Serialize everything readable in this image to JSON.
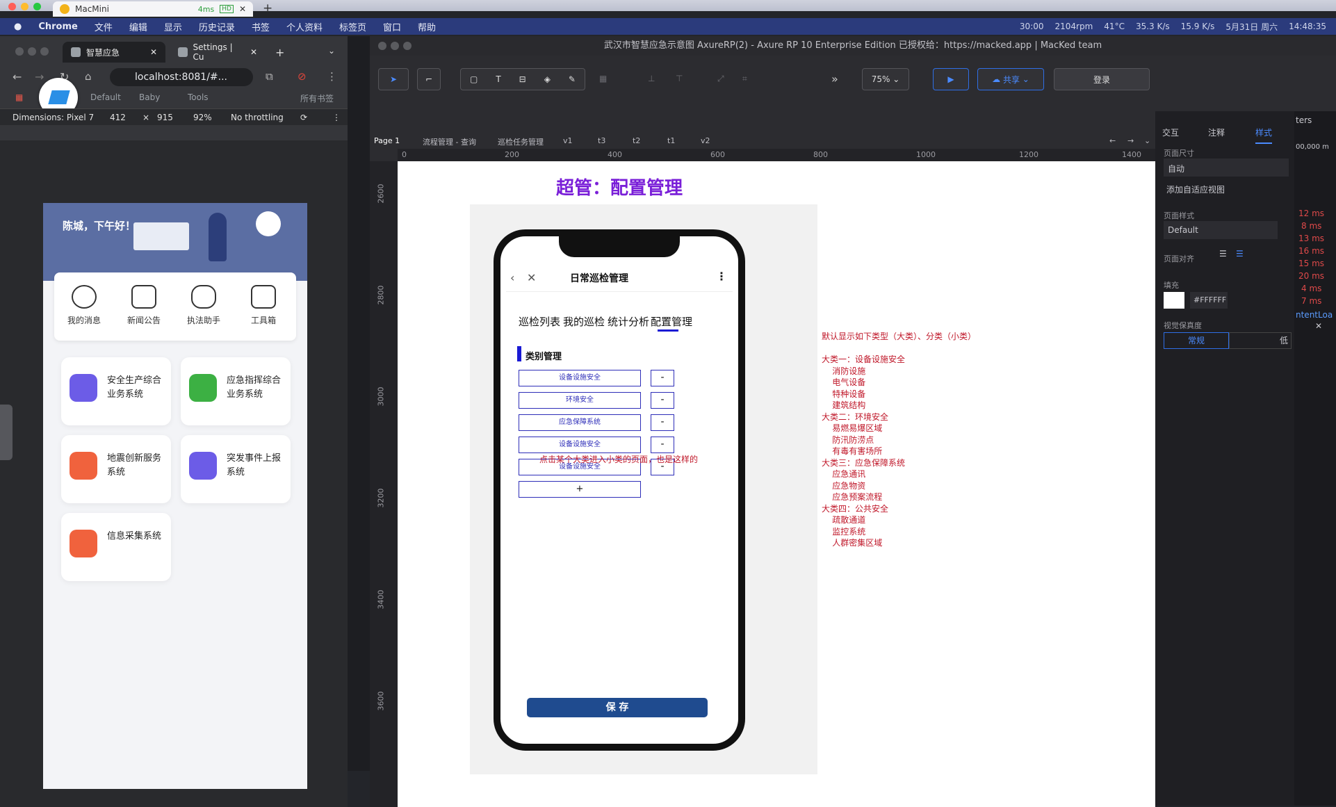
{
  "os": {
    "tab_title": "MacMini",
    "tab_ping": "4ms",
    "tab_hd": "HD"
  },
  "menubar": {
    "apple": "",
    "items": [
      "Chrome",
      "文件",
      "编辑",
      "显示",
      "历史记录",
      "书签",
      "个人资料",
      "标签页",
      "窗口",
      "帮助"
    ],
    "status": [
      "30:00",
      "2104rpm",
      "41°C",
      "35.3 K/s",
      "15.9 K/s",
      "5月31日 周六",
      "14:48:35"
    ]
  },
  "chrome": {
    "tabs": [
      "智慧应急",
      "Settings | Cu"
    ],
    "address": "localhost:8081/#...",
    "bookmarks": [
      "Default",
      "Baby",
      "Tools",
      "所有书签"
    ],
    "device": {
      "dimensions_label": "Dimensions: Pixel 7",
      "width": "412",
      "height": "915",
      "zoom": "92%",
      "throttling": "No throttling"
    }
  },
  "app": {
    "greeting": "陈城，下午好！",
    "quick_entries": [
      "我的消息",
      "新闻公告",
      "执法助手",
      "工具箱"
    ],
    "cards": [
      {
        "label": "安全生产综合业务系统",
        "color": "#6c5ce7"
      },
      {
        "label": "应急指挥综合业务系统",
        "color": "#3cb043"
      },
      {
        "label": "地震创新服务系统",
        "color": "#f0623d"
      },
      {
        "label": "突发事件上报系统",
        "color": "#6c5ce7"
      },
      {
        "label": "信息采集系统",
        "color": "#f0623d"
      }
    ]
  },
  "axure": {
    "window_title": "武汉市智慧应急示意图 AxureRP(2) - Axure RP 10 Enterprise Edition 已授权给：https://macked.app | MacKed team",
    "zoom": "75%",
    "share": "共享",
    "login": "登录",
    "page_tabs": [
      "Page 1",
      "流程管理 - 查询",
      "巡检任务管理",
      "v1",
      "t3",
      "t2",
      "t1",
      "v2"
    ],
    "ruler_marks": [
      "0",
      "200",
      "400",
      "600",
      "800",
      "1000",
      "1200",
      "1400"
    ],
    "ruler_v_marks": [
      "2600",
      "2800",
      "3000",
      "3200",
      "3400",
      "3600"
    ],
    "canvas": {
      "page_title": "超管：配置管理",
      "phone_header": "日常巡检管理",
      "tabs": [
        "巡检列表",
        "我的巡检",
        "统计分析",
        "配置管理"
      ],
      "section": "类别管理",
      "categories": [
        "设备设施安全",
        "环境安全",
        "应急保障系统",
        "设备设施安全",
        "设备设施安全"
      ],
      "minus_label": "-",
      "add_label": "+",
      "hint": "点击某个大类进入小类的页面，也是这样的",
      "save_label": "保 存",
      "note": "默认显示如下类型（大类）、分类（小类）\n\n大类一：设备设施安全\n    消防设施\n    电气设备\n    特种设备\n    建筑结构\n大类二：环境安全\n    易燃易爆区域\n    防汛防涝点\n    有毒有害场所\n大类三：应急保障系统\n    应急通讯\n    应急物资\n    应急预案流程\n大类四：公共安全\n    疏散通道\n    监控系统\n    人群密集区域"
    },
    "right_panel": {
      "tabs": [
        "交互",
        "注释",
        "样式"
      ],
      "page_size_label": "页面尺寸",
      "page_size_value": "自动",
      "add_adaptive": "添加自适应视图",
      "page_style_label": "页面样式",
      "page_style_value": "Default",
      "align_label": "页面对齐",
      "fill_label": "填充",
      "fill_value": "#FFFFFF",
      "fidelity_label": "视觉保真度",
      "fidelity_options": [
        "常规",
        "低"
      ]
    },
    "far_panel": {
      "top": "ters",
      "value": "00,000 m",
      "ms": [
        "12 ms",
        "8 ms",
        "13 ms",
        "16 ms",
        "15 ms",
        "20 ms",
        "4 ms",
        "7 ms"
      ],
      "tail": "ntentLoa"
    }
  }
}
